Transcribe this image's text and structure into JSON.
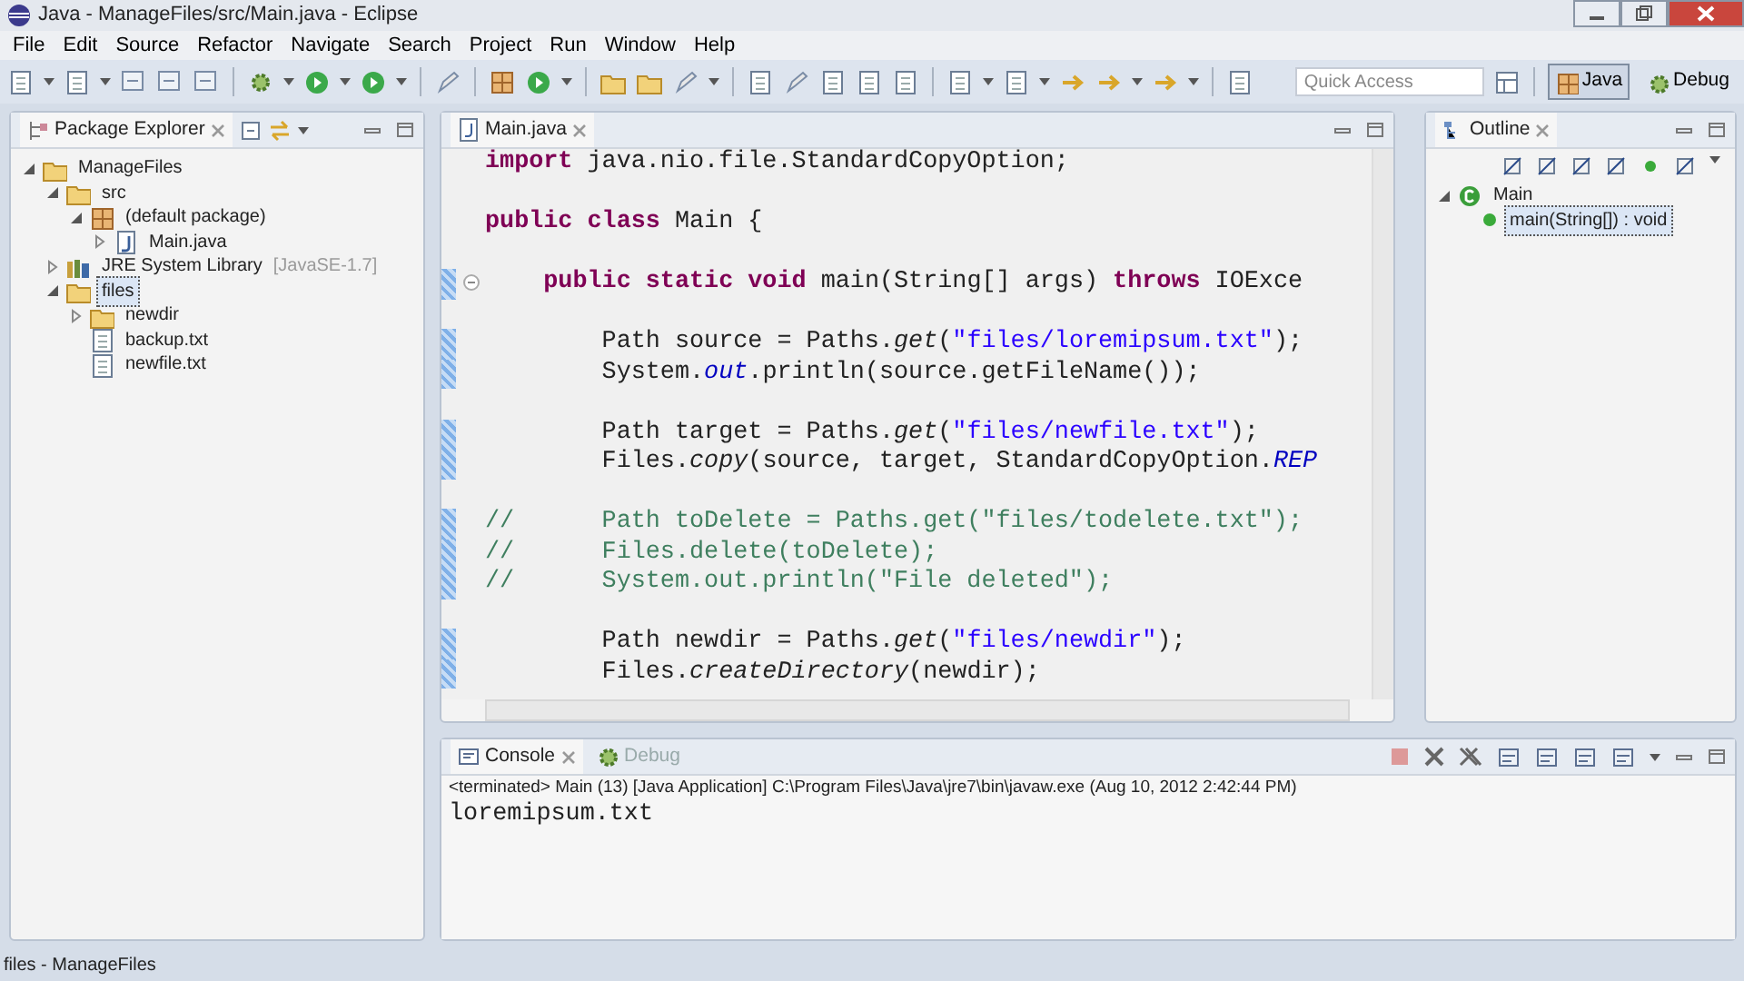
{
  "window": {
    "title": "Java - ManageFiles/src/Main.java - Eclipse"
  },
  "menu": [
    "File",
    "Edit",
    "Source",
    "Refactor",
    "Navigate",
    "Search",
    "Project",
    "Run",
    "Window",
    "Help"
  ],
  "quick_access": {
    "placeholder": "Quick Access"
  },
  "perspectives": [
    {
      "label": "Java",
      "selected": true
    },
    {
      "label": "Debug",
      "selected": false
    }
  ],
  "package_explorer": {
    "title": "Package Explorer",
    "tree": [
      {
        "label": "ManageFiles",
        "kind": "project",
        "expanded": true,
        "selected": false,
        "children": [
          {
            "label": "src",
            "kind": "source-folder",
            "expanded": true,
            "selected": false,
            "children": [
              {
                "label": "(default package)",
                "kind": "package",
                "expanded": true,
                "selected": false,
                "children": [
                  {
                    "label": "Main.java",
                    "kind": "java-file",
                    "expanded": false,
                    "selected": false
                  }
                ]
              }
            ]
          },
          {
            "label": "JRE System Library",
            "decoration": "[JavaSE-1.7]",
            "kind": "library",
            "expanded": false,
            "selected": false
          },
          {
            "label": "files",
            "kind": "folder",
            "expanded": true,
            "selected": true,
            "children": [
              {
                "label": "newdir",
                "kind": "folder",
                "expanded": false,
                "selected": false
              },
              {
                "label": "backup.txt",
                "kind": "file",
                "selected": false
              },
              {
                "label": "newfile.txt",
                "kind": "file",
                "selected": false
              }
            ]
          }
        ]
      }
    ]
  },
  "editor": {
    "tab": "Main.java",
    "lines": [
      {
        "gap_before": false,
        "changed": false,
        "foldable": false,
        "tokens": [
          {
            "kind": "kw",
            "text": "import"
          },
          {
            "kind": "text",
            "text": " java.nio.file.StandardCopyOption;"
          }
        ]
      },
      {
        "gap_before": true,
        "changed": false,
        "foldable": false,
        "tokens": [
          {
            "kind": "kw",
            "text": "public class"
          },
          {
            "kind": "text",
            "text": " Main {"
          }
        ]
      },
      {
        "gap_before": true,
        "changed": true,
        "foldable": true,
        "tokens": [
          {
            "kind": "kw",
            "text": "    public static void"
          },
          {
            "kind": "text",
            "text": " main(String[] args) "
          },
          {
            "kind": "kw",
            "text": "throws"
          },
          {
            "kind": "text",
            "text": " IOExce"
          }
        ]
      },
      {
        "gap_before": true,
        "changed": true,
        "foldable": false,
        "tokens": [
          {
            "kind": "text",
            "text": "        Path source = Paths."
          },
          {
            "kind": "static-method",
            "text": "get"
          },
          {
            "kind": "text",
            "text": "("
          },
          {
            "kind": "str",
            "text": "\"files/loremipsum.txt\""
          },
          {
            "kind": "text",
            "text": ");"
          }
        ]
      },
      {
        "gap_before": false,
        "changed": true,
        "foldable": false,
        "tokens": [
          {
            "kind": "text",
            "text": "        System."
          },
          {
            "kind": "static-field",
            "text": "out"
          },
          {
            "kind": "text",
            "text": ".println(source.getFileName());"
          }
        ]
      },
      {
        "gap_before": true,
        "changed": true,
        "foldable": false,
        "tokens": [
          {
            "kind": "text",
            "text": "        Path target = Paths."
          },
          {
            "kind": "static-method",
            "text": "get"
          },
          {
            "kind": "text",
            "text": "("
          },
          {
            "kind": "str",
            "text": "\"files/newfile.txt\""
          },
          {
            "kind": "text",
            "text": ");"
          }
        ]
      },
      {
        "gap_before": false,
        "changed": true,
        "foldable": false,
        "tokens": [
          {
            "kind": "text",
            "text": "        Files."
          },
          {
            "kind": "static-method",
            "text": "copy"
          },
          {
            "kind": "text",
            "text": "(source, target, StandardCopyOption."
          },
          {
            "kind": "static-field",
            "text": "REP"
          }
        ]
      },
      {
        "gap_before": true,
        "changed": true,
        "foldable": false,
        "tokens": [
          {
            "kind": "comment",
            "text": "//      Path toDelete = Paths.get(\"files/todelete.txt\");"
          }
        ]
      },
      {
        "gap_before": false,
        "changed": true,
        "foldable": false,
        "tokens": [
          {
            "kind": "comment",
            "text": "//      Files.delete(toDelete);"
          }
        ]
      },
      {
        "gap_before": false,
        "changed": true,
        "foldable": false,
        "tokens": [
          {
            "kind": "comment",
            "text": "//      System.out.println(\"File deleted\");"
          }
        ]
      },
      {
        "gap_before": true,
        "changed": true,
        "foldable": false,
        "tokens": [
          {
            "kind": "text",
            "text": "        Path newdir = Paths."
          },
          {
            "kind": "static-method",
            "text": "get"
          },
          {
            "kind": "text",
            "text": "("
          },
          {
            "kind": "str",
            "text": "\"files/newdir\""
          },
          {
            "kind": "text",
            "text": ");"
          }
        ]
      },
      {
        "gap_before": false,
        "changed": true,
        "foldable": false,
        "tokens": [
          {
            "kind": "text",
            "text": "        Files."
          },
          {
            "kind": "static-method",
            "text": "createDirectory"
          },
          {
            "kind": "text",
            "text": "(newdir);"
          }
        ]
      }
    ]
  },
  "outline": {
    "title": "Outline",
    "tree": [
      {
        "label": "Main",
        "kind": "class",
        "expanded": true,
        "selected": false,
        "children": [
          {
            "label": "main(String[]) : void",
            "kind": "method",
            "selected": true
          }
        ]
      }
    ]
  },
  "console": {
    "tabs": [
      {
        "label": "Console",
        "selected": true
      },
      {
        "label": "Debug",
        "selected": false
      }
    ],
    "status": "<terminated> Main (13) [Java Application] C:\\Program Files\\Java\\jre7\\bin\\javaw.exe (Aug 10, 2012 2:42:44 PM)",
    "output": "loremipsum.txt"
  },
  "status_bar": "files - ManageFiles"
}
